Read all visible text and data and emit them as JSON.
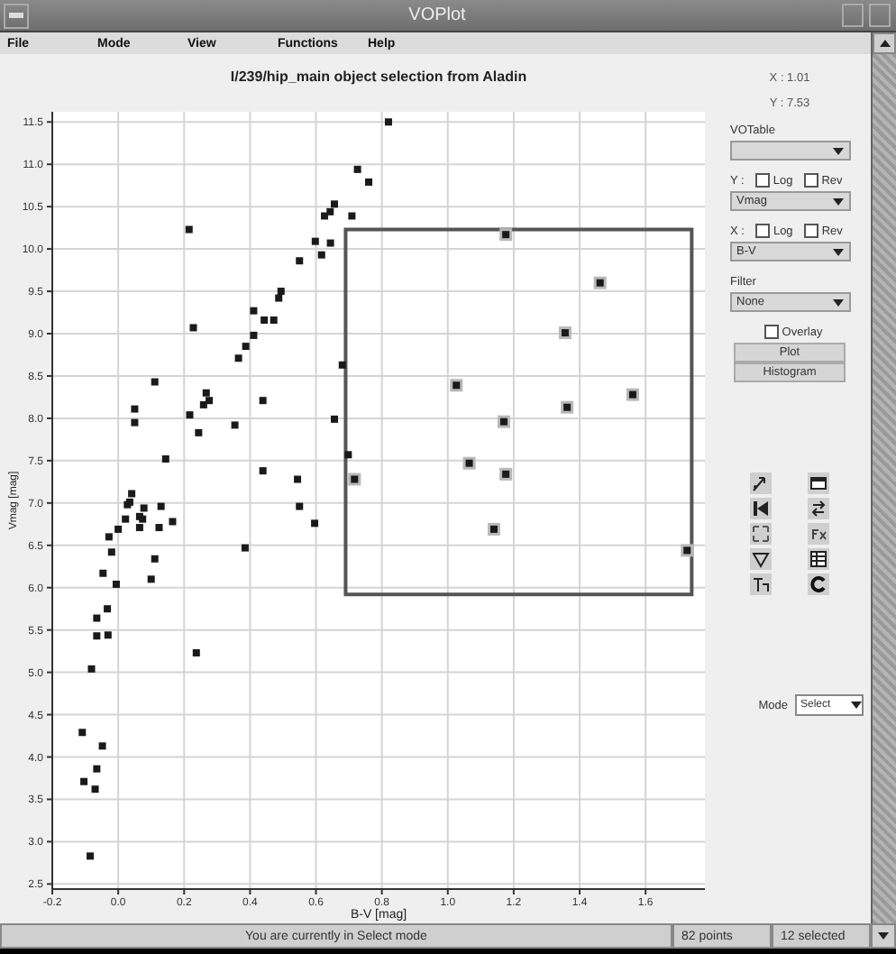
{
  "window": {
    "title": "VOPlot"
  },
  "menu": [
    "File",
    "Mode",
    "View",
    "Functions",
    "Help"
  ],
  "plot": {
    "chart_data": {
      "type": "scatter",
      "title": "I/239/hip_main object selection from Aladin",
      "xlabel": "B-V [mag]",
      "ylabel": "Vmag [mag]",
      "xlim": [
        -0.2,
        1.78
      ],
      "ylim": [
        2.44,
        11.62
      ],
      "xticks": [
        {
          "value": -0.2,
          "label": "-0.2"
        },
        {
          "value": 0,
          "label": "0.0"
        },
        {
          "value": 0.2,
          "label": "0.2"
        },
        {
          "value": 0.4,
          "label": "0.4"
        },
        {
          "value": 0.6,
          "label": "0.6"
        },
        {
          "value": 0.8,
          "label": "0.8"
        },
        {
          "value": 1.0,
          "label": "1.0"
        },
        {
          "value": 1.2,
          "label": "1.2"
        },
        {
          "value": 1.4,
          "label": "1.4"
        },
        {
          "value": 1.6,
          "label": "1.6"
        }
      ],
      "yticks": [
        {
          "value": 2.5,
          "label": "2.5"
        },
        {
          "value": 3,
          "label": "3.0"
        },
        {
          "value": 3.5,
          "label": "3.5"
        },
        {
          "value": 4,
          "label": "4.0"
        },
        {
          "value": 4.5,
          "label": "4.5"
        },
        {
          "value": 5,
          "label": "5.0"
        },
        {
          "value": 5.5,
          "label": "5.5"
        },
        {
          "value": 6,
          "label": "6.0"
        },
        {
          "value": 6.5,
          "label": "6.5"
        },
        {
          "value": 7,
          "label": "7.0"
        },
        {
          "value": 7.5,
          "label": "7.5"
        },
        {
          "value": 8,
          "label": "8.0"
        },
        {
          "value": 8.5,
          "label": "8.5"
        },
        {
          "value": 9,
          "label": "9.0"
        },
        {
          "value": 9.5,
          "label": "9.5"
        },
        {
          "value": 10,
          "label": "10.0"
        },
        {
          "value": 10.5,
          "label": "10.5"
        },
        {
          "value": 11,
          "label": "11.0"
        },
        {
          "value": 11.5,
          "label": "11.5"
        }
      ],
      "series": [
        {
          "color": "#1a1a1a",
          "x": [
            0.82,
            0.726,
            0.76,
            0.656,
            0.643,
            0.626,
            0.709,
            0.598,
            0.644,
            0.617,
            0.55,
            0.494,
            0.487,
            0.411,
            0.443,
            0.472,
            0.411,
            0.387,
            0.365,
            0.68,
            0.439,
            0.267,
            0.276,
            0.259,
            0.217,
            0.244,
            0.354,
            0.656,
            0.698,
            0.544,
            0.439,
            0.55,
            0.596,
            0.385,
            0.215,
            0.228,
            0.111,
            0.05,
            0.05,
            0.144,
            0.041,
            0.035,
            0.028,
            0.078,
            0.13,
            0.065,
            0.074,
            0.022,
            0.065,
            0.124,
            0.165,
            0.0,
            -0.028,
            -0.02,
            0.111,
            -0.046,
            0.1,
            -0.006,
            -0.033,
            -0.065,
            -0.065,
            -0.031,
            -0.081,
            0.237,
            -0.109,
            -0.048,
            -0.065,
            -0.104,
            -0.07,
            -0.085
          ],
          "values": [
            11.5,
            10.94,
            10.79,
            10.53,
            10.44,
            10.39,
            10.39,
            10.09,
            10.07,
            9.93,
            9.86,
            9.5,
            9.42,
            9.27,
            9.16,
            9.16,
            8.98,
            8.85,
            8.71,
            8.63,
            8.21,
            8.3,
            8.21,
            8.16,
            8.04,
            7.83,
            7.92,
            7.99,
            7.57,
            7.28,
            7.38,
            6.96,
            6.76,
            6.47,
            10.23,
            9.07,
            8.43,
            8.11,
            7.95,
            7.52,
            7.11,
            7.01,
            6.98,
            6.94,
            6.96,
            6.84,
            6.81,
            6.81,
            6.71,
            6.71,
            6.78,
            6.69,
            6.6,
            6.42,
            6.34,
            6.17,
            6.1,
            6.04,
            5.75,
            5.64,
            5.43,
            5.44,
            5.04,
            5.23,
            4.29,
            4.13,
            3.86,
            3.71,
            3.62,
            2.83
          ]
        },
        {
          "color": "#1a1a1a",
          "x": [
            1.176,
            1.462,
            1.356,
            1.026,
            1.561,
            1.362,
            1.17,
            1.065,
            1.176,
            1.14,
            1.726,
            0.717
          ],
          "values": [
            10.17,
            9.6,
            9.01,
            8.39,
            8.28,
            8.13,
            7.96,
            7.47,
            7.34,
            6.69,
            6.44,
            7.28
          ]
        }
      ],
      "grid": true
    },
    "selection": {
      "series_selected": [
        false,
        true
      ]
    }
  },
  "side_panel": {
    "x_readout": "X : 1.01",
    "y_readout": "Y : 7.53",
    "votable": {
      "label": "VOTable"
    },
    "y_axis": {
      "label": "Y :",
      "log": {
        "label": "Log",
        "checked": false
      },
      "rev": {
        "label": "Rev",
        "checked": false
      },
      "column": "Vmag"
    },
    "x_axis": {
      "label": "X :",
      "log": {
        "label": "Log",
        "checked": false
      },
      "rev": {
        "label": "Rev",
        "checked": false
      },
      "column": "B-V"
    },
    "filter": {
      "label": "Filter",
      "value": "None"
    },
    "overlay": {
      "label": "Overlay",
      "checked": false
    },
    "buttons": [
      "Plot",
      "Histogram"
    ],
    "mode": {
      "label": "Mode",
      "value": "Select"
    }
  },
  "status_bar": {
    "message": "You are currently in Select mode",
    "points": "82 points",
    "selected": "12 selected"
  }
}
